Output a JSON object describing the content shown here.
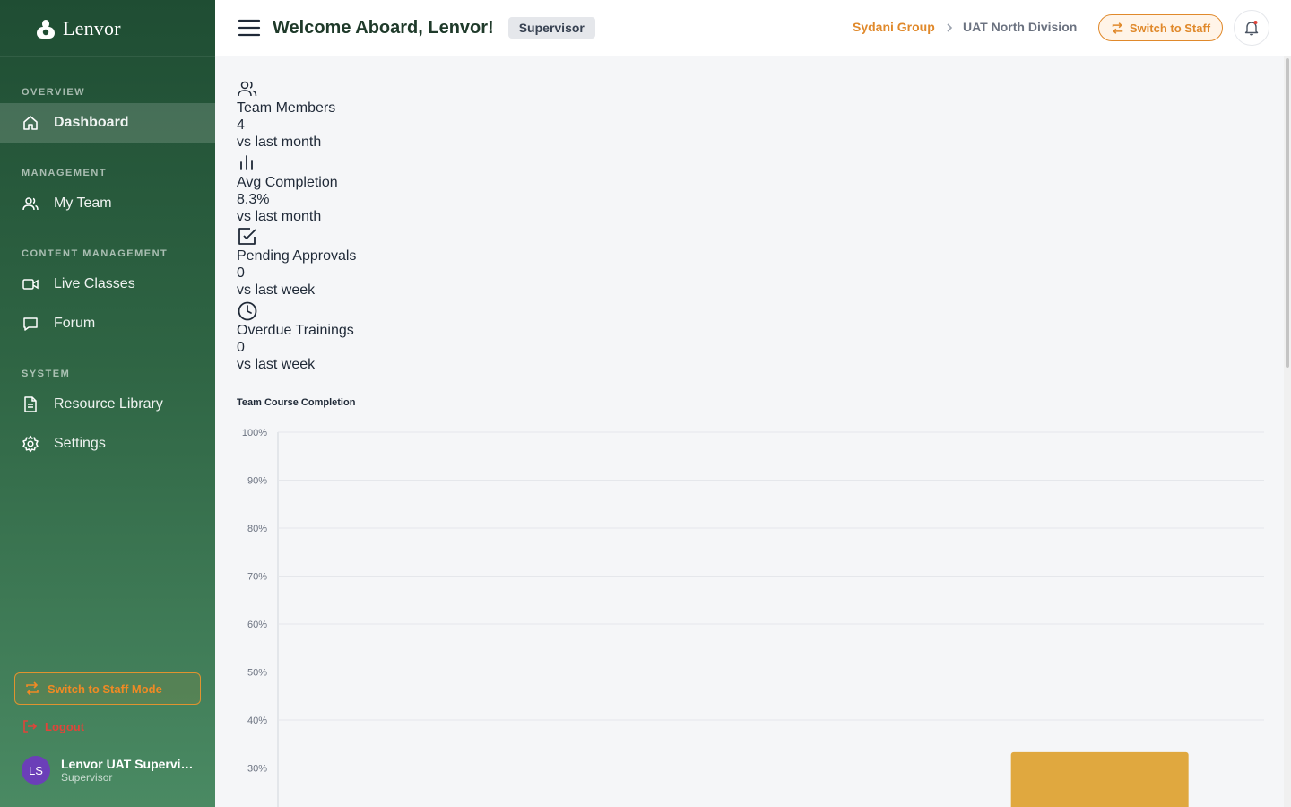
{
  "app": {
    "name": "Lenvor"
  },
  "sidebar": {
    "sections": [
      {
        "label": "OVERVIEW",
        "items": [
          {
            "label": "Dashboard",
            "icon": "home-icon",
            "active": true
          }
        ]
      },
      {
        "label": "MANAGEMENT",
        "items": [
          {
            "label": "My Team",
            "icon": "users-icon"
          }
        ]
      },
      {
        "label": "CONTENT MANAGEMENT",
        "items": [
          {
            "label": "Live Classes",
            "icon": "video-icon"
          },
          {
            "label": "Forum",
            "icon": "chat-icon"
          }
        ]
      },
      {
        "label": "SYSTEM",
        "items": [
          {
            "label": "Resource Library",
            "icon": "document-icon"
          },
          {
            "label": "Settings",
            "icon": "gear-icon"
          }
        ]
      }
    ],
    "switch_mode_label": "Switch to Staff Mode",
    "logout_label": "Logout",
    "user": {
      "initials": "LS",
      "name": "Lenvor UAT Supervisor",
      "role": "Supervisor"
    }
  },
  "header": {
    "welcome": "Welcome Aboard, Lenvor!",
    "role_badge": "Supervisor",
    "breadcrumb": {
      "org": "Sydani Group",
      "division": "UAT North Division"
    },
    "switch_label": "Switch to Staff"
  },
  "stats": [
    {
      "label": "Team Members",
      "value": "4",
      "compare": "vs last month",
      "icon": "users-icon"
    },
    {
      "label": "Avg Completion",
      "value": "8.3%",
      "compare": "vs last month",
      "icon": "bar-chart-icon"
    },
    {
      "label": "Pending Approvals",
      "value": "0",
      "compare": "vs last week",
      "icon": "checkbox-icon"
    },
    {
      "label": "Overdue Trainings",
      "value": "0",
      "compare": "vs last week",
      "icon": "clock-icon"
    }
  ],
  "colors": {
    "sidebar_top": "#1f4d33",
    "sidebar_bottom": "#4a8a63",
    "accent": "#e0892b",
    "bar": "#e0a83f",
    "danger": "#e0443a"
  },
  "chart_data": {
    "type": "bar",
    "title": "Team Course Completion",
    "categories": [
      "",
      "",
      ""
    ],
    "values": [
      0,
      0,
      33.3
    ],
    "ylim": [
      0,
      100
    ],
    "yticks": [
      "100%",
      "90%",
      "80%",
      "70%",
      "60%",
      "50%",
      "40%",
      "30%"
    ],
    "grid": true
  }
}
